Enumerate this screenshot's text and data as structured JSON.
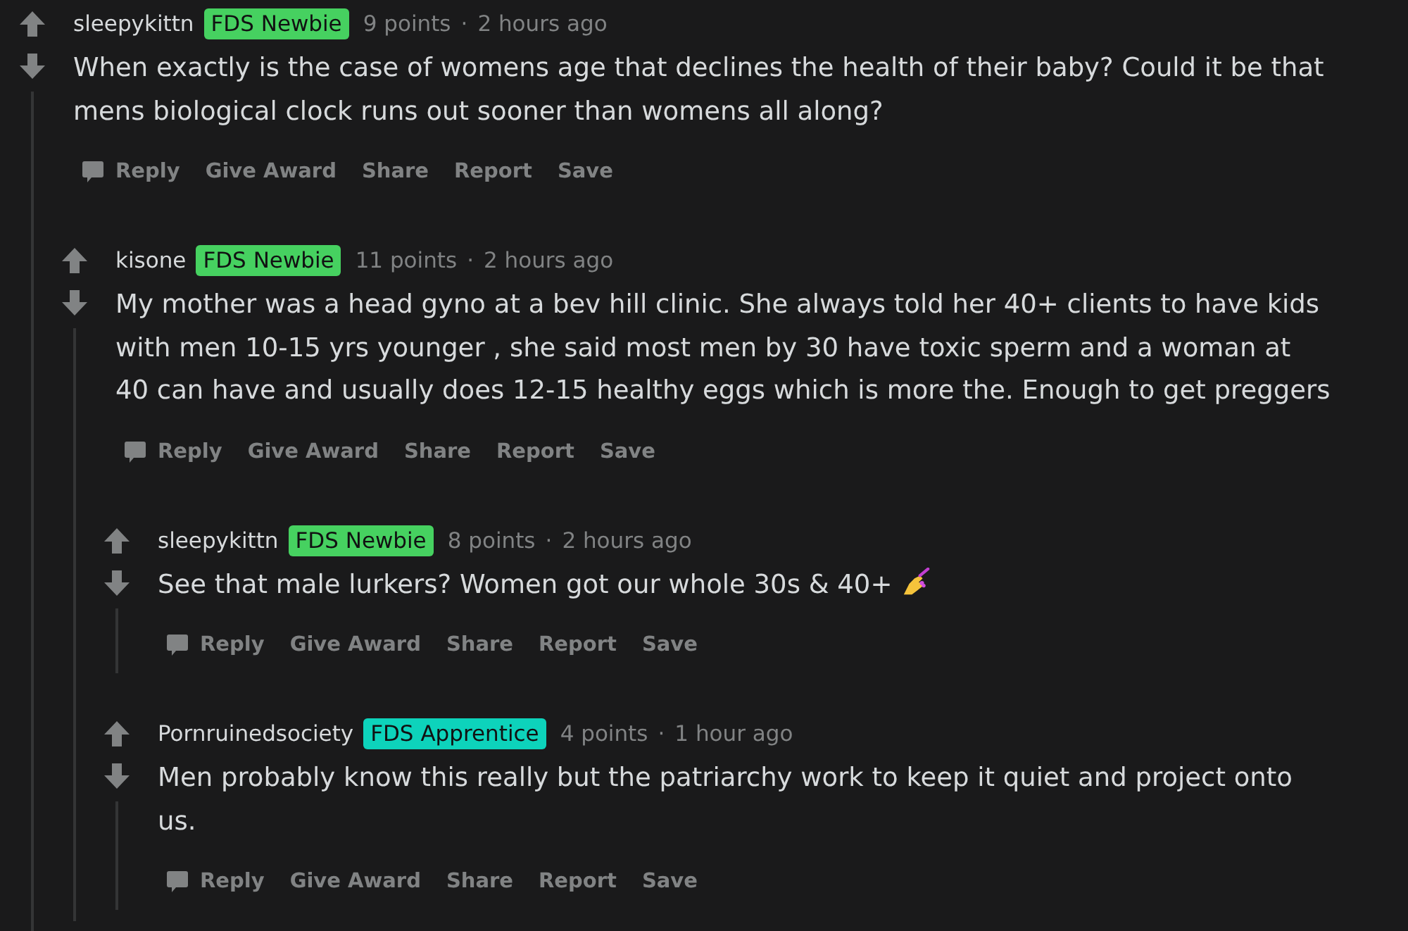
{
  "comments": [
    {
      "username": "sleepykittn",
      "flair": {
        "text": "FDS Newbie",
        "color": "#46d160"
      },
      "points": "9 points",
      "separator": "·",
      "time": "2 hours ago",
      "body": "When exactly is the case of womens age that declines the health of their baby? Could it be that mens biological clock runs out sooner than womens all along?",
      "emoji": false,
      "actions": [
        {
          "label": "Reply",
          "kind": "reply"
        },
        {
          "label": "Give Award",
          "kind": "award"
        },
        {
          "label": "Share",
          "kind": "share"
        },
        {
          "label": "Report",
          "kind": "report"
        },
        {
          "label": "Save",
          "kind": "save"
        }
      ],
      "children": [
        {
          "username": "kisone",
          "flair": {
            "text": "FDS Newbie",
            "color": "#46d160"
          },
          "points": "11 points",
          "separator": "·",
          "time": "2 hours ago",
          "body": "My mother was a head gyno at a bev hill clinic. She always told her 40+ clients to have kids with men 10-15 yrs younger , she said most men by 30 have toxic sperm and a woman at 40 can have and usually does 12-15 healthy eggs which is more the. Enough to get preggers",
          "emoji": false,
          "actions": [
            {
              "label": "Reply",
              "kind": "reply"
            },
            {
              "label": "Give Award",
              "kind": "award"
            },
            {
              "label": "Share",
              "kind": "share"
            },
            {
              "label": "Report",
              "kind": "report"
            },
            {
              "label": "Save",
              "kind": "save"
            }
          ],
          "children": [
            {
              "username": "sleepykittn",
              "flair": {
                "text": "FDS Newbie",
                "color": "#46d160"
              },
              "points": "8 points",
              "separator": "·",
              "time": "2 hours ago",
              "body": "See that male lurkers? Women got our whole 30s & 40+",
              "emoji": true,
              "actions": [
                {
                  "label": "Reply",
                  "kind": "reply"
                },
                {
                  "label": "Give Award",
                  "kind": "award"
                },
                {
                  "label": "Share",
                  "kind": "share"
                },
                {
                  "label": "Report",
                  "kind": "report"
                },
                {
                  "label": "Save",
                  "kind": "save"
                }
              ]
            },
            {
              "username": "Pornruinedsociety",
              "flair": {
                "text": "FDS Apprentice",
                "color": "#0dd3bb"
              },
              "points": "4 points",
              "separator": "·",
              "time": "1 hour ago",
              "body": "Men probably know this really but the patriarchy work to keep it quiet and project onto us.",
              "emoji": false,
              "actions": [
                {
                  "label": "Reply",
                  "kind": "reply"
                },
                {
                  "label": "Give Award",
                  "kind": "award"
                },
                {
                  "label": "Share",
                  "kind": "share"
                },
                {
                  "label": "Report",
                  "kind": "report"
                },
                {
                  "label": "Save",
                  "kind": "save"
                }
              ]
            }
          ]
        }
      ]
    }
  ]
}
